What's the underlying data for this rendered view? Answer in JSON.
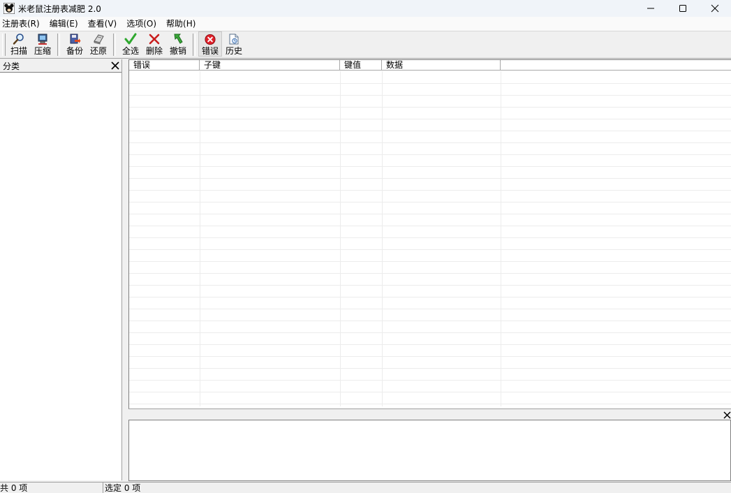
{
  "window": {
    "title": "米老鼠注册表减肥 2.0",
    "minimize_icon": "minimize-icon",
    "maximize_icon": "maximize-icon",
    "close_icon": "close-icon"
  },
  "menu": [
    {
      "label": "注册表(R)"
    },
    {
      "label": "编辑(E)"
    },
    {
      "label": "查看(V)"
    },
    {
      "label": "选项(O)"
    },
    {
      "label": "帮助(H)"
    }
  ],
  "toolbar": {
    "scan": {
      "label": "扫描",
      "icon": "magnifier-icon"
    },
    "compress": {
      "label": "压缩",
      "icon": "compress-icon"
    },
    "backup": {
      "label": "备份",
      "icon": "backup-icon"
    },
    "restore": {
      "label": "还原",
      "icon": "restore-icon"
    },
    "select_all": {
      "label": "全选",
      "icon": "check-icon"
    },
    "delete": {
      "label": "删除",
      "icon": "cross-icon"
    },
    "undo": {
      "label": "撤销",
      "icon": "undo-arrow-icon"
    },
    "errors": {
      "label": "错误",
      "icon": "error-icon"
    },
    "history": {
      "label": "历史",
      "icon": "history-icon"
    }
  },
  "left_panel": {
    "title": "分类"
  },
  "grid": {
    "columns": [
      "错误",
      "子键",
      "键值",
      "数据"
    ],
    "rows": []
  },
  "status": {
    "total": "共 0 项",
    "selected": "选定 0 项"
  },
  "colors": {
    "error_red": "#e0202a",
    "check_green": "#2fa82f"
  }
}
